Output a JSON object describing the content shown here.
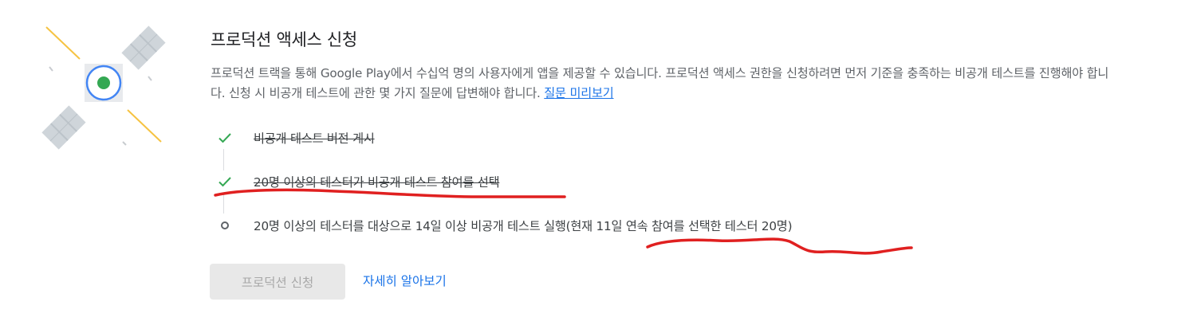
{
  "header": {
    "title": "프로덕션 액세스 신청"
  },
  "description": {
    "text": "프로덕션 트랙을 통해 Google Play에서 수십억 명의 사용자에게 앱을 제공할 수 있습니다. 프로덕션 액세스 권한을 신청하려면 먼저 기준을 충족하는 비공개 테스트를 진행해야 합니다. 신청 시 비공개 테스트에 관한 몇 가지 질문에 답변해야 합니다.",
    "link_label": "질문 미리보기"
  },
  "requirements": [
    {
      "label": "비공개 테스트 버전 게시",
      "status": "completed"
    },
    {
      "label": "20명 이상의 테스터가 비공개 테스트 참여를 선택",
      "status": "completed"
    },
    {
      "label": "20명 이상의 테스터를 대상으로 14일 이상 비공개 테스트 실행(현재 11일 연속 참여를 선택한 테스터 20명)",
      "status": "pending"
    }
  ],
  "actions": {
    "apply_label": "프로덕션 신청",
    "apply_enabled": false,
    "learn_more_label": "자세히 알아보기"
  },
  "colors": {
    "check": "#34a853",
    "link": "#1a73e8",
    "annotation": "#e02020",
    "disabled_bg": "#e8e8e8"
  },
  "icons": {
    "illustration": "satellite-illustration",
    "done_marker": "check-icon",
    "pending_marker": "circle-outline-icon"
  }
}
